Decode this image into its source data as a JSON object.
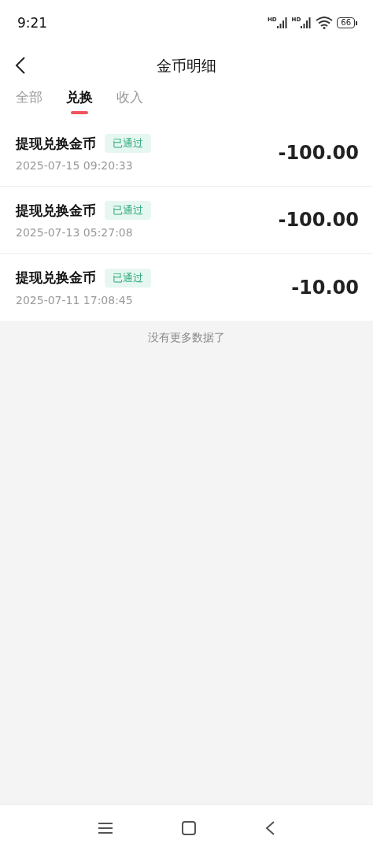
{
  "status_bar": {
    "time": "9:21",
    "signals": [
      {
        "label": "HD"
      },
      {
        "label": "HD"
      }
    ],
    "battery": "66"
  },
  "header": {
    "title": "金币明细"
  },
  "tabs": [
    {
      "label": "全部",
      "selected": false
    },
    {
      "label": "兑换",
      "selected": true
    },
    {
      "label": "收入",
      "selected": false
    }
  ],
  "records": [
    {
      "title": "提现兑换金币",
      "status": "已通过",
      "time": "2025-07-15 09:20:33",
      "amount": "-100.00"
    },
    {
      "title": "提现兑换金币",
      "status": "已通过",
      "time": "2025-07-13 05:27:08",
      "amount": "-100.00"
    },
    {
      "title": "提现兑换金币",
      "status": "已通过",
      "time": "2025-07-11 17:08:45",
      "amount": "-10.00"
    }
  ],
  "footer_note": "没有更多数据了"
}
